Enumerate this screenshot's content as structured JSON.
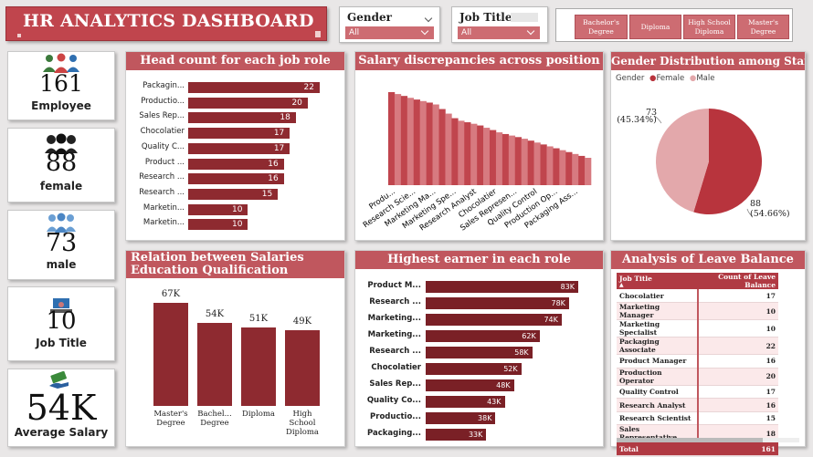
{
  "title": "HR ANALYTICS DASHBOARD",
  "filters": {
    "gender": {
      "label": "Gender",
      "value": "All"
    },
    "job_title": {
      "label": "Job Title",
      "value": "All"
    },
    "education": [
      "Bachelor's Degree",
      "Diploma",
      "High School Diploma",
      "Master's Degree"
    ]
  },
  "kpis": [
    {
      "value": "161",
      "label": "Employee",
      "icon": "people-group-icon"
    },
    {
      "value": "88",
      "label": "female",
      "icon": "women-group-icon"
    },
    {
      "value": "73",
      "label": "male",
      "icon": "men-group-icon"
    },
    {
      "value": "10",
      "label": "Job Title",
      "icon": "worker-desk-icon"
    },
    {
      "value": "54K",
      "label": "Average Salary",
      "icon": "money-hand-icon"
    }
  ],
  "headcount": {
    "title": "Head count for each job role",
    "rows": [
      {
        "label": "Packagin...",
        "value": 22
      },
      {
        "label": "Productio...",
        "value": 20
      },
      {
        "label": "Sales Rep...",
        "value": 18
      },
      {
        "label": "Chocolatier",
        "value": 17
      },
      {
        "label": "Quality C...",
        "value": 17
      },
      {
        "label": "Product ...",
        "value": 16
      },
      {
        "label": "Research ...",
        "value": 16
      },
      {
        "label": "Research ...",
        "value": 15
      },
      {
        "label": "Marketin...",
        "value": 10
      },
      {
        "label": "Marketin...",
        "value": 10
      }
    ]
  },
  "salary_disc": {
    "title": "Salary discrepancies across position",
    "labels": [
      "Produ...",
      "Research Scie...",
      "Marketing Ma...",
      "Marketing Spe...",
      "Research Analyst",
      "Chocolatier",
      "Sales Represen...",
      "Quality Control",
      "Production Op...",
      "Packaging Ass..."
    ]
  },
  "gender_dist": {
    "title": "Gender Distribution among Staff",
    "legend_title": "Gender",
    "legend": [
      {
        "name": "Female",
        "color": "#b8343d"
      },
      {
        "name": "Male",
        "color": "#e3a8ab"
      }
    ],
    "female_label": "88",
    "female_pct": "(54.66%)",
    "male_label": "73",
    "male_pct": "(45.34%)",
    "female_value": 88,
    "male_value": 73
  },
  "edu_salary": {
    "title": "Relation between Salaries Education Qualification",
    "bars": [
      {
        "label": "Master's Degree",
        "value": "67K",
        "num": 67
      },
      {
        "label": "Bachel... Degree",
        "value": "54K",
        "num": 54
      },
      {
        "label": "Diploma",
        "value": "51K",
        "num": 51
      },
      {
        "label": "High School Diploma",
        "value": "49K",
        "num": 49
      }
    ]
  },
  "highest_earner": {
    "title": "Highest earner in each role",
    "rows": [
      {
        "label": "Product M...",
        "value": "83K",
        "num": 83
      },
      {
        "label": "Research ...",
        "value": "78K",
        "num": 78
      },
      {
        "label": "Marketing...",
        "value": "74K",
        "num": 74
      },
      {
        "label": "Marketing...",
        "value": "62K",
        "num": 62
      },
      {
        "label": "Research ...",
        "value": "58K",
        "num": 58
      },
      {
        "label": "Chocolatier",
        "value": "52K",
        "num": 52
      },
      {
        "label": "Sales Rep...",
        "value": "48K",
        "num": 48
      },
      {
        "label": "Quality Co...",
        "value": "43K",
        "num": 43
      },
      {
        "label": "Productio...",
        "value": "38K",
        "num": 38
      },
      {
        "label": "Packaging...",
        "value": "33K",
        "num": 33
      }
    ]
  },
  "leave": {
    "title": "Analysis of Leave Balance",
    "col1": "Job Title",
    "col2": "Count of Leave Balance",
    "rows": [
      {
        "job": "Chocolatier",
        "count": "17"
      },
      {
        "job": "Marketing Manager",
        "count": "10"
      },
      {
        "job": "Marketing Specialist",
        "count": "10"
      },
      {
        "job": "Packaging Associate",
        "count": "22"
      },
      {
        "job": "Product Manager",
        "count": "16"
      },
      {
        "job": "Production Operator",
        "count": "20"
      },
      {
        "job": "Quality Control",
        "count": "17"
      },
      {
        "job": "Research Analyst",
        "count": "16"
      },
      {
        "job": "Research Scientist",
        "count": "15"
      },
      {
        "job": "Sales Representative",
        "count": "18"
      }
    ],
    "total_label": "Total",
    "total_value": "161"
  },
  "chart_data": [
    {
      "type": "bar",
      "title": "Head count for each job role",
      "categories": [
        "Packagin...",
        "Productio...",
        "Sales Rep...",
        "Chocolatier",
        "Quality C...",
        "Product ...",
        "Research ...",
        "Research ...",
        "Marketin...",
        "Marketin..."
      ],
      "values": [
        22,
        20,
        18,
        17,
        17,
        16,
        16,
        15,
        10,
        10
      ]
    },
    {
      "type": "area",
      "title": "Salary discrepancies across position",
      "categories": [
        "Produ...",
        "Research Scie...",
        "Marketing Ma...",
        "Marketing Spe...",
        "Research Analyst",
        "Chocolatier",
        "Sales Represen...",
        "Quality Control",
        "Production Op...",
        "Packaging Ass..."
      ],
      "values": [
        83,
        78,
        74,
        62,
        58,
        52,
        48,
        43,
        38,
        33
      ]
    },
    {
      "type": "pie",
      "title": "Gender Distribution among Staff",
      "categories": [
        "Female",
        "Male"
      ],
      "values": [
        88,
        73
      ]
    },
    {
      "type": "bar",
      "title": "Relation between Salaries Education Qualification",
      "categories": [
        "Master's Degree",
        "Bachel... Degree",
        "Diploma",
        "High School Diploma"
      ],
      "values": [
        67,
        54,
        51,
        49
      ]
    },
    {
      "type": "bar",
      "title": "Highest earner in each role",
      "categories": [
        "Product M...",
        "Research ...",
        "Marketing...",
        "Marketing...",
        "Research ...",
        "Chocolatier",
        "Sales Rep...",
        "Quality Co...",
        "Productio...",
        "Packaging..."
      ],
      "values": [
        83,
        78,
        74,
        62,
        58,
        52,
        48,
        43,
        38,
        33
      ]
    }
  ]
}
